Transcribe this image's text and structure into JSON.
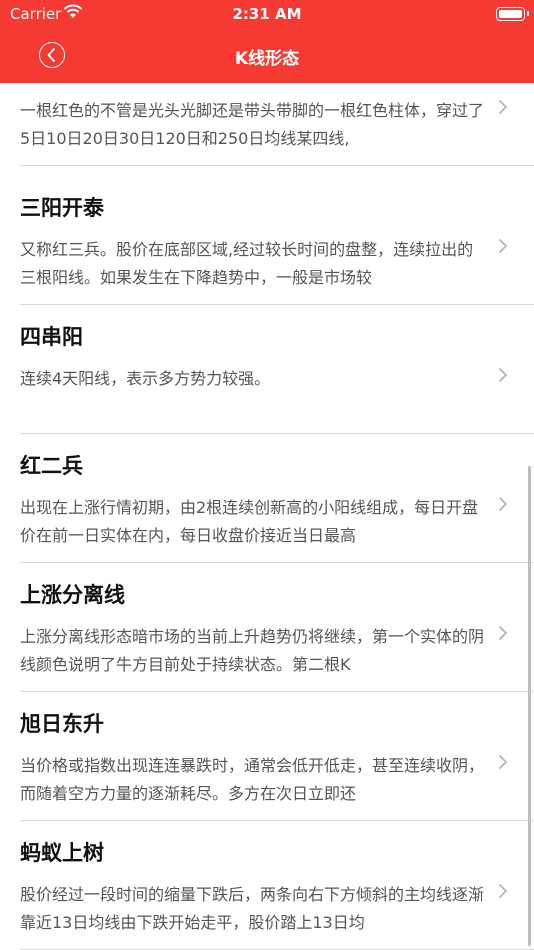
{
  "status": {
    "carrier": "Carrier",
    "time": "2:31 AM"
  },
  "nav": {
    "title": "K线形态"
  },
  "items": [
    {
      "title": "",
      "desc": "一根红色的不管是光头光脚还是带头带脚的一根红色柱体，穿过了5日10日20日30日120日和250日均线某四线,"
    },
    {
      "title": "三阳开泰",
      "desc": "又称红三兵。股价在底部区域,经过较长时间的盘整，连续拉出的三根阳线。如果发生在下降趋势中，一般是市场较"
    },
    {
      "title": "四串阳",
      "desc": "连续4天阳线，表示多方势力较强。"
    },
    {
      "title": "红二兵",
      "desc": "出现在上涨行情初期，由2根连续创新高的小阳线组成，每日开盘价在前一日实体在内，每日收盘价接近当日最高"
    },
    {
      "title": "上涨分离线",
      "desc": "上涨分离线形态暗市场的当前上升趋势仍将继续，第一个实体的阴线颜色说明了牛方目前处于持续状态。第二根K"
    },
    {
      "title": "旭日东升",
      "desc": "当价格或指数出现连连暴跌时，通常会低开低走，甚至连续收阴，而随着空方力量的逐渐耗尽。多方在次日立即还"
    },
    {
      "title": "蚂蚁上树",
      "desc": "股价经过一段时间的缩量下跌后，两条向右下方倾斜的主均线逐渐靠近13日均线由下跌开始走平，股价踏上13日均"
    }
  ]
}
